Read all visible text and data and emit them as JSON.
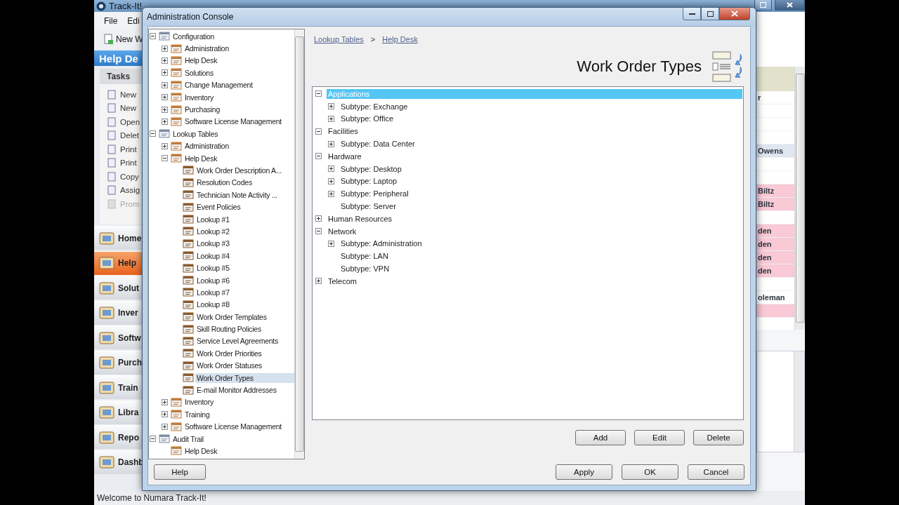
{
  "background_app": {
    "title": "Track-It!",
    "menu": [
      "File",
      "Edi"
    ],
    "toolbar": [
      "New W"
    ],
    "section_title": "Help De",
    "tasks_tab": "Tasks",
    "tasks": [
      {
        "label": "New",
        "disabled": false
      },
      {
        "label": "New",
        "disabled": false
      },
      {
        "label": "Open",
        "disabled": false
      },
      {
        "label": "Delet",
        "disabled": false
      },
      {
        "label": "Print",
        "disabled": false
      },
      {
        "label": "Print",
        "disabled": false
      },
      {
        "label": "Copy",
        "disabled": false
      },
      {
        "label": "Assig",
        "disabled": false
      },
      {
        "label": "Prom",
        "disabled": true
      }
    ],
    "nav": [
      {
        "label": "Home",
        "selected": false
      },
      {
        "label": "Help",
        "selected": true
      },
      {
        "label": "Solut",
        "selected": false
      },
      {
        "label": "Inver",
        "selected": false
      },
      {
        "label": "Softw",
        "selected": false
      },
      {
        "label": "Purch",
        "selected": false
      },
      {
        "label": "Train",
        "selected": false
      },
      {
        "label": "Libra",
        "selected": false
      },
      {
        "label": "Repo",
        "selected": false
      },
      {
        "label": "Dashb",
        "selected": false
      }
    ],
    "list_rows": [
      {
        "text": "r",
        "color": "#ffffff"
      },
      {
        "color": "#ffffff"
      },
      {
        "color": "#ffffff"
      },
      {
        "color": "#ffffff"
      },
      {
        "text": "Owens",
        "color": "#dfe6ef"
      },
      {
        "color": "#ffffff"
      },
      {
        "color": "#ffffff"
      },
      {
        "text": "Biltz",
        "color": "#f9c9d5"
      },
      {
        "text": "Biltz",
        "color": "#f9c9d5"
      },
      {
        "color": "#ffffff"
      },
      {
        "text": "den",
        "color": "#f9c9d5"
      },
      {
        "text": "den",
        "color": "#f9c9d5"
      },
      {
        "text": "den",
        "color": "#f9c9d5"
      },
      {
        "text": "den",
        "color": "#f9c9d5"
      },
      {
        "color": "#ffffff"
      },
      {
        "text": "oleman",
        "color": "#ffffff"
      },
      {
        "color": "#f9c9d5"
      }
    ],
    "status_bar": "Welcome to Numara Track-It!"
  },
  "dialog": {
    "title": "Administration Console",
    "nav_tree": [
      {
        "label": "Configuration",
        "expanded": true,
        "selected": false,
        "children": [
          {
            "label": "Administration",
            "expanded": false,
            "selected": false
          },
          {
            "label": "Help Desk",
            "expanded": false,
            "selected": false
          },
          {
            "label": "Solutions",
            "expanded": false,
            "selected": false
          },
          {
            "label": "Change Management",
            "expanded": false,
            "selected": false
          },
          {
            "label": "Inventory",
            "expanded": false,
            "selected": false
          },
          {
            "label": "Purchasing",
            "expanded": false,
            "selected": false
          },
          {
            "label": "Software License Management",
            "expanded": false,
            "selected": false
          }
        ]
      },
      {
        "label": "Lookup Tables",
        "expanded": true,
        "selected": false,
        "children": [
          {
            "label": "Administration",
            "expanded": false,
            "selected": false
          },
          {
            "label": "Help Desk",
            "expanded": true,
            "selected": false,
            "children": [
              {
                "label": "Work Order Description A...",
                "selected": false
              },
              {
                "label": "Resolution Codes",
                "selected": false
              },
              {
                "label": "Technician Note Activity ...",
                "selected": false
              },
              {
                "label": "Event Policies",
                "selected": false
              },
              {
                "label": "Lookup #1",
                "selected": false
              },
              {
                "label": "Lookup #2",
                "selected": false
              },
              {
                "label": "Lookup #3",
                "selected": false
              },
              {
                "label": "Lookup #4",
                "selected": false
              },
              {
                "label": "Lookup #5",
                "selected": false
              },
              {
                "label": "Lookup #6",
                "selected": false
              },
              {
                "label": "Lookup #7",
                "selected": false
              },
              {
                "label": "Lookup #8",
                "selected": false
              },
              {
                "label": "Work Order Templates",
                "selected": false
              },
              {
                "label": "Skill Routing Policies",
                "selected": false
              },
              {
                "label": "Service Level Agreements",
                "selected": false
              },
              {
                "label": "Work Order Priorities",
                "selected": false
              },
              {
                "label": "Work Order Statuses",
                "selected": false
              },
              {
                "label": "Work Order Types",
                "selected": true
              },
              {
                "label": "E-mail Monitor Addresses",
                "selected": false
              }
            ]
          },
          {
            "label": "Inventory",
            "expanded": false,
            "selected": false
          },
          {
            "label": "Training",
            "expanded": false,
            "selected": false
          },
          {
            "label": "Software License Management",
            "expanded": false,
            "selected": false
          }
        ]
      },
      {
        "label": "Audit Trail",
        "expanded": true,
        "selected": false,
        "children": [
          {
            "label": "Help Desk",
            "selected": false
          }
        ]
      }
    ],
    "breadcrumb": [
      "Lookup Tables",
      "Help Desk"
    ],
    "breadcrumb_separator": ">",
    "heading": "Work Order Types",
    "types_tree": [
      {
        "label": "Applications",
        "expanded": true,
        "selected": true,
        "children": [
          {
            "label": "Subtype: Exchange",
            "expanded": false,
            "selected": false
          },
          {
            "label": "Subtype: Office",
            "expanded": false,
            "selected": false
          }
        ]
      },
      {
        "label": "Facilities",
        "expanded": true,
        "selected": false,
        "children": [
          {
            "label": "Subtype: Data Center",
            "expanded": false,
            "selected": false
          }
        ]
      },
      {
        "label": "Hardware",
        "expanded": true,
        "selected": false,
        "children": [
          {
            "label": "Subtype: Desktop",
            "expanded": false,
            "selected": false
          },
          {
            "label": "Subtype: Laptop",
            "expanded": false,
            "selected": false
          },
          {
            "label": "Subtype: Peripheral",
            "expanded": false,
            "selected": false
          },
          {
            "label": "Subtype: Server",
            "selected": false
          }
        ]
      },
      {
        "label": "Human Resources",
        "expanded": false,
        "selected": false
      },
      {
        "label": "Network",
        "expanded": true,
        "selected": false,
        "children": [
          {
            "label": "Subtype: Administration",
            "expanded": false,
            "selected": false
          },
          {
            "label": "Subtype: LAN",
            "selected": false
          },
          {
            "label": "Subtype: VPN",
            "selected": false
          }
        ]
      },
      {
        "label": "Telecom",
        "expanded": false,
        "selected": false
      }
    ],
    "actions": [
      "Add",
      "Edit",
      "Delete"
    ],
    "help_button": "Help",
    "buttons": [
      "Apply",
      "OK",
      "Cancel"
    ]
  }
}
